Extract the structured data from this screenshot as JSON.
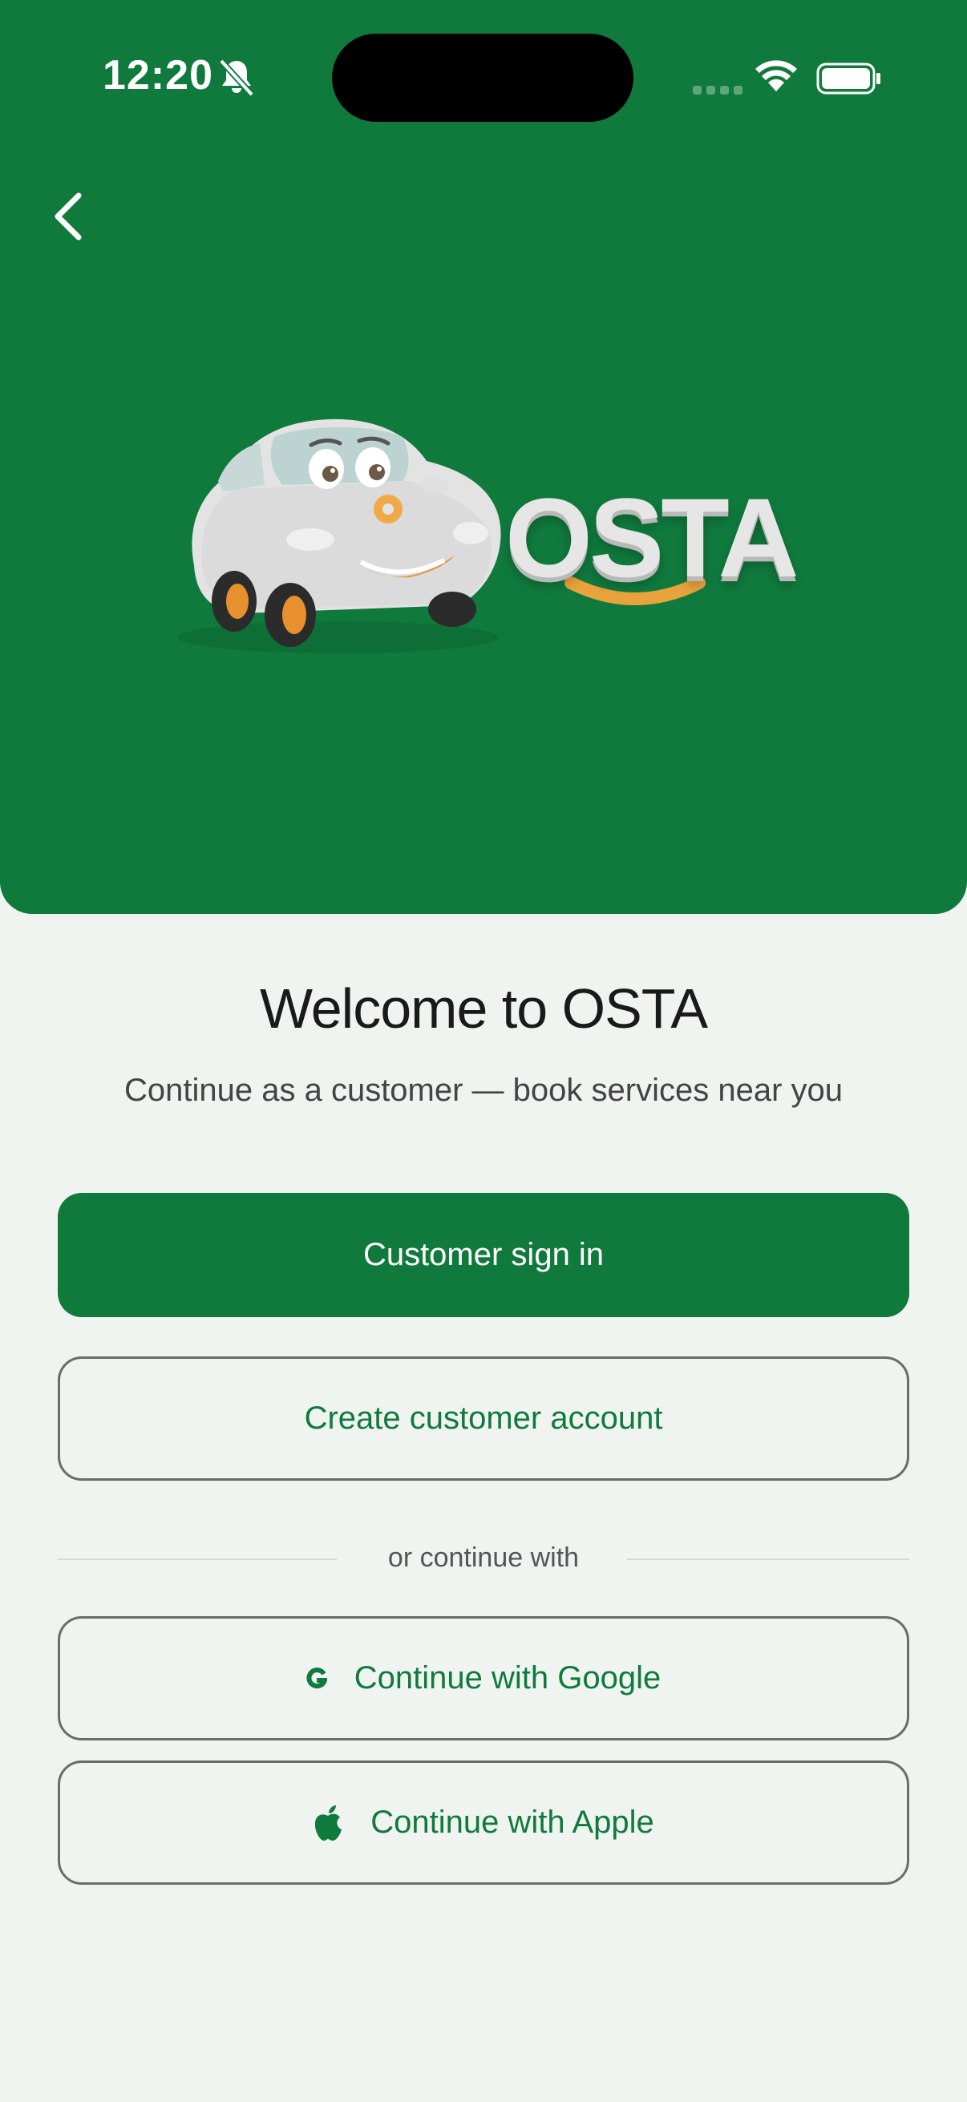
{
  "status_bar": {
    "time": "12:20"
  },
  "brand": {
    "name": "OSTA",
    "primary_color": "#107a3d",
    "accent_color": "#e8a33c"
  },
  "welcome": {
    "title": "Welcome to OSTA",
    "subtitle": "Continue as a customer — book services near you"
  },
  "actions": {
    "sign_in_label": "Customer sign in",
    "create_account_label": "Create customer account",
    "divider_text": "or continue with",
    "google_label": "Continue with Google",
    "apple_label": "Continue with Apple"
  },
  "icons": {
    "back": "chevron-left-icon",
    "bell": "bell-slash-icon",
    "wifi": "wifi-icon",
    "battery": "battery-icon",
    "google": "google-icon",
    "apple": "apple-icon"
  }
}
